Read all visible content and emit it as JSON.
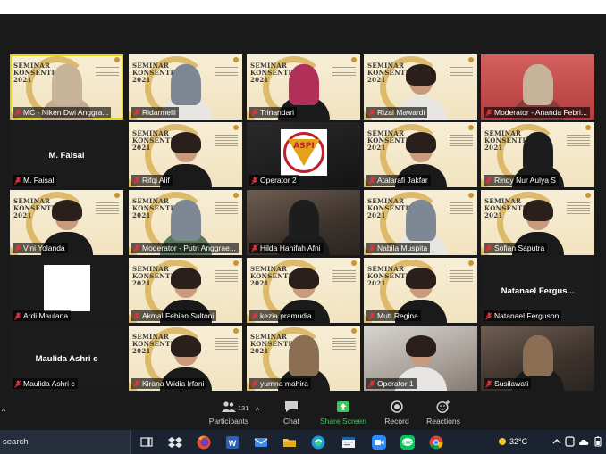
{
  "tiles": [
    {
      "label": "MC - Niken Dwi Anggra...",
      "type": "banner",
      "speaking": true,
      "banner": "SEMINAR\nKONSENTRASI\n2021"
    },
    {
      "label": "Ridarmelli",
      "type": "banner",
      "banner": "SEMINAR\nKONSENTRASI\n2021"
    },
    {
      "label": "Trinandari",
      "type": "banner",
      "banner": "SEMINAR\nKONSENTRASI\n2021"
    },
    {
      "label": "Rizal Mawardi",
      "type": "banner",
      "banner": "SEMINAR\nKONSENTRASI\n2021"
    },
    {
      "label": "Moderator - Ananda Febri...",
      "type": "red"
    },
    {
      "label": "M. Faisal",
      "type": "blank",
      "center_name": "M. Faisal"
    },
    {
      "label": "Rifqi Alif",
      "type": "banner",
      "banner": "SEMINAR\nKONSENTRASI\n2021"
    },
    {
      "label": "Operator 2",
      "type": "logo",
      "logo_text": "ASPI"
    },
    {
      "label": "Atalarafi Jakfar",
      "type": "banner",
      "banner": "SEMINAR\nKONSENTRASI\n2021"
    },
    {
      "label": "Rindy Nur Aulya S",
      "type": "banner",
      "banner": "SEMINAR\nKONSENTRASI\n2021"
    },
    {
      "label": "Vini Yolanda",
      "type": "banner",
      "banner": "SEMINAR\nKONSENTRASI\n2021"
    },
    {
      "label": "Moderator - Putri Anggrae...",
      "type": "banner",
      "banner": "SEMINAR\nKONSENTRASI\n2021"
    },
    {
      "label": "Hilda Hanifah Afni",
      "type": "cam"
    },
    {
      "label": "Nabila Muspita",
      "type": "banner",
      "banner": "SEMINAR\nKONSENTRASI\n2021"
    },
    {
      "label": "Sofian Saputra",
      "type": "banner",
      "banner": "SEMINAR\nKONSENTRASI\n2021"
    },
    {
      "label": "Ardi Maulana",
      "type": "whitebox"
    },
    {
      "label": "Akmal Febian Sultoni",
      "type": "banner",
      "banner": "SEMINAR\nKONSENTRASI\n2021"
    },
    {
      "label": "kezia pramudia",
      "type": "banner",
      "banner": "SEMINAR\nKONSENTRASI\n2021"
    },
    {
      "label": "Mutt Regina",
      "type": "banner",
      "banner": "SEMINAR\nKONSENTRASI\n2021"
    },
    {
      "label": "Natanael Ferguson",
      "type": "blank",
      "center_name": "Natanael Fergus..."
    },
    {
      "label": "Maulida Ashri c",
      "type": "blank",
      "center_name": "Maulida Ashri c"
    },
    {
      "label": "Kirana Widia Irfani",
      "type": "banner",
      "banner": "SEMINAR\nKONSENTRASI\n2021"
    },
    {
      "label": "yumna mahira",
      "type": "banner",
      "banner": "SEMINAR\nKONSENTRASI\n2021"
    },
    {
      "label": "Operator 1",
      "type": "camlight"
    },
    {
      "label": "Susilawati",
      "type": "cam"
    }
  ],
  "toolbar": {
    "participants_label": "Participants",
    "participants_count": "131",
    "chat_label": "Chat",
    "share_label": "Share Screen",
    "record_label": "Record",
    "reactions_label": "Reactions"
  },
  "taskbar": {
    "search_placeholder": "search",
    "temperature": "32°C"
  },
  "colors": {
    "share_green": "#3ec35e",
    "speaking_outline": "#e6d21e",
    "zoom_bg": "#1a1a1a",
    "taskbar_bg": "#1b2230"
  }
}
